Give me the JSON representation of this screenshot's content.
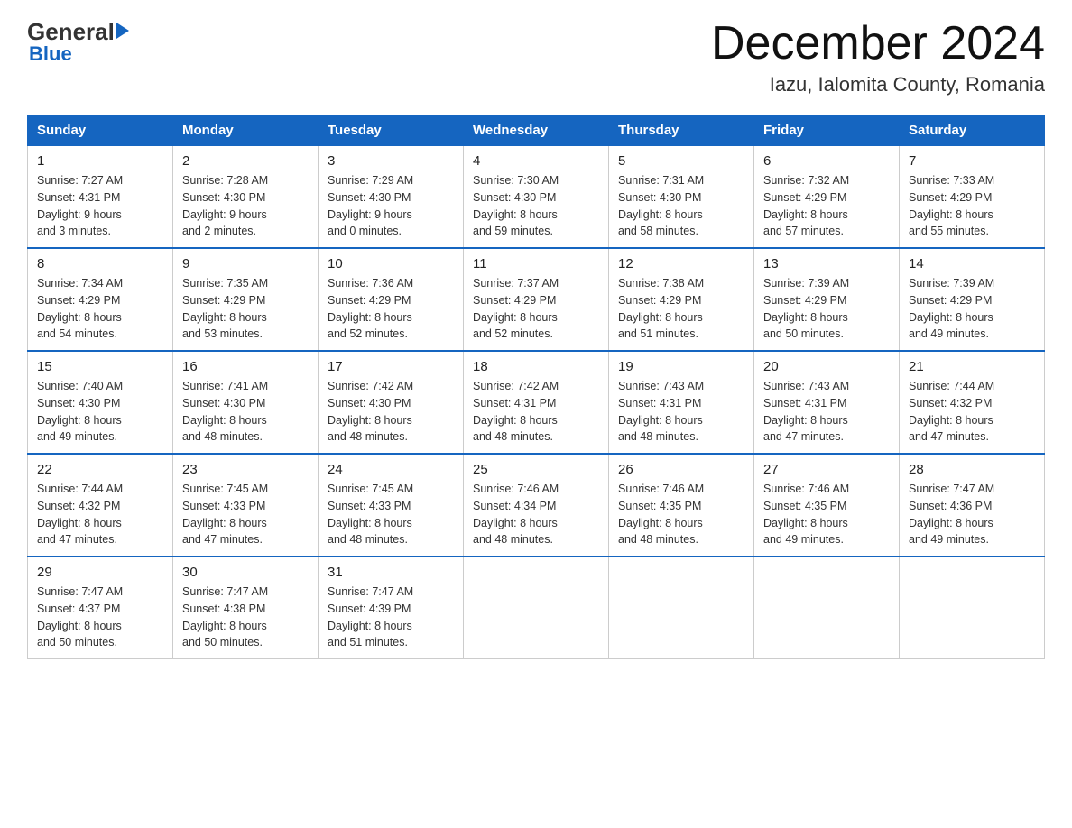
{
  "logo": {
    "general": "General",
    "blue": "Blue"
  },
  "header": {
    "month": "December 2024",
    "location": "Iazu, Ialomita County, Romania"
  },
  "days_of_week": [
    "Sunday",
    "Monday",
    "Tuesday",
    "Wednesday",
    "Thursday",
    "Friday",
    "Saturday"
  ],
  "weeks": [
    [
      {
        "day": "1",
        "sunrise": "7:27 AM",
        "sunset": "4:31 PM",
        "daylight": "9 hours and 3 minutes."
      },
      {
        "day": "2",
        "sunrise": "7:28 AM",
        "sunset": "4:30 PM",
        "daylight": "9 hours and 2 minutes."
      },
      {
        "day": "3",
        "sunrise": "7:29 AM",
        "sunset": "4:30 PM",
        "daylight": "9 hours and 0 minutes."
      },
      {
        "day": "4",
        "sunrise": "7:30 AM",
        "sunset": "4:30 PM",
        "daylight": "8 hours and 59 minutes."
      },
      {
        "day": "5",
        "sunrise": "7:31 AM",
        "sunset": "4:30 PM",
        "daylight": "8 hours and 58 minutes."
      },
      {
        "day": "6",
        "sunrise": "7:32 AM",
        "sunset": "4:29 PM",
        "daylight": "8 hours and 57 minutes."
      },
      {
        "day": "7",
        "sunrise": "7:33 AM",
        "sunset": "4:29 PM",
        "daylight": "8 hours and 55 minutes."
      }
    ],
    [
      {
        "day": "8",
        "sunrise": "7:34 AM",
        "sunset": "4:29 PM",
        "daylight": "8 hours and 54 minutes."
      },
      {
        "day": "9",
        "sunrise": "7:35 AM",
        "sunset": "4:29 PM",
        "daylight": "8 hours and 53 minutes."
      },
      {
        "day": "10",
        "sunrise": "7:36 AM",
        "sunset": "4:29 PM",
        "daylight": "8 hours and 52 minutes."
      },
      {
        "day": "11",
        "sunrise": "7:37 AM",
        "sunset": "4:29 PM",
        "daylight": "8 hours and 52 minutes."
      },
      {
        "day": "12",
        "sunrise": "7:38 AM",
        "sunset": "4:29 PM",
        "daylight": "8 hours and 51 minutes."
      },
      {
        "day": "13",
        "sunrise": "7:39 AM",
        "sunset": "4:29 PM",
        "daylight": "8 hours and 50 minutes."
      },
      {
        "day": "14",
        "sunrise": "7:39 AM",
        "sunset": "4:29 PM",
        "daylight": "8 hours and 49 minutes."
      }
    ],
    [
      {
        "day": "15",
        "sunrise": "7:40 AM",
        "sunset": "4:30 PM",
        "daylight": "8 hours and 49 minutes."
      },
      {
        "day": "16",
        "sunrise": "7:41 AM",
        "sunset": "4:30 PM",
        "daylight": "8 hours and 48 minutes."
      },
      {
        "day": "17",
        "sunrise": "7:42 AM",
        "sunset": "4:30 PM",
        "daylight": "8 hours and 48 minutes."
      },
      {
        "day": "18",
        "sunrise": "7:42 AM",
        "sunset": "4:31 PM",
        "daylight": "8 hours and 48 minutes."
      },
      {
        "day": "19",
        "sunrise": "7:43 AM",
        "sunset": "4:31 PM",
        "daylight": "8 hours and 48 minutes."
      },
      {
        "day": "20",
        "sunrise": "7:43 AM",
        "sunset": "4:31 PM",
        "daylight": "8 hours and 47 minutes."
      },
      {
        "day": "21",
        "sunrise": "7:44 AM",
        "sunset": "4:32 PM",
        "daylight": "8 hours and 47 minutes."
      }
    ],
    [
      {
        "day": "22",
        "sunrise": "7:44 AM",
        "sunset": "4:32 PM",
        "daylight": "8 hours and 47 minutes."
      },
      {
        "day": "23",
        "sunrise": "7:45 AM",
        "sunset": "4:33 PM",
        "daylight": "8 hours and 47 minutes."
      },
      {
        "day": "24",
        "sunrise": "7:45 AM",
        "sunset": "4:33 PM",
        "daylight": "8 hours and 48 minutes."
      },
      {
        "day": "25",
        "sunrise": "7:46 AM",
        "sunset": "4:34 PM",
        "daylight": "8 hours and 48 minutes."
      },
      {
        "day": "26",
        "sunrise": "7:46 AM",
        "sunset": "4:35 PM",
        "daylight": "8 hours and 48 minutes."
      },
      {
        "day": "27",
        "sunrise": "7:46 AM",
        "sunset": "4:35 PM",
        "daylight": "8 hours and 49 minutes."
      },
      {
        "day": "28",
        "sunrise": "7:47 AM",
        "sunset": "4:36 PM",
        "daylight": "8 hours and 49 minutes."
      }
    ],
    [
      {
        "day": "29",
        "sunrise": "7:47 AM",
        "sunset": "4:37 PM",
        "daylight": "8 hours and 50 minutes."
      },
      {
        "day": "30",
        "sunrise": "7:47 AM",
        "sunset": "4:38 PM",
        "daylight": "8 hours and 50 minutes."
      },
      {
        "day": "31",
        "sunrise": "7:47 AM",
        "sunset": "4:39 PM",
        "daylight": "8 hours and 51 minutes."
      },
      null,
      null,
      null,
      null
    ]
  ],
  "labels": {
    "sunrise": "Sunrise:",
    "sunset": "Sunset:",
    "daylight": "Daylight:"
  }
}
